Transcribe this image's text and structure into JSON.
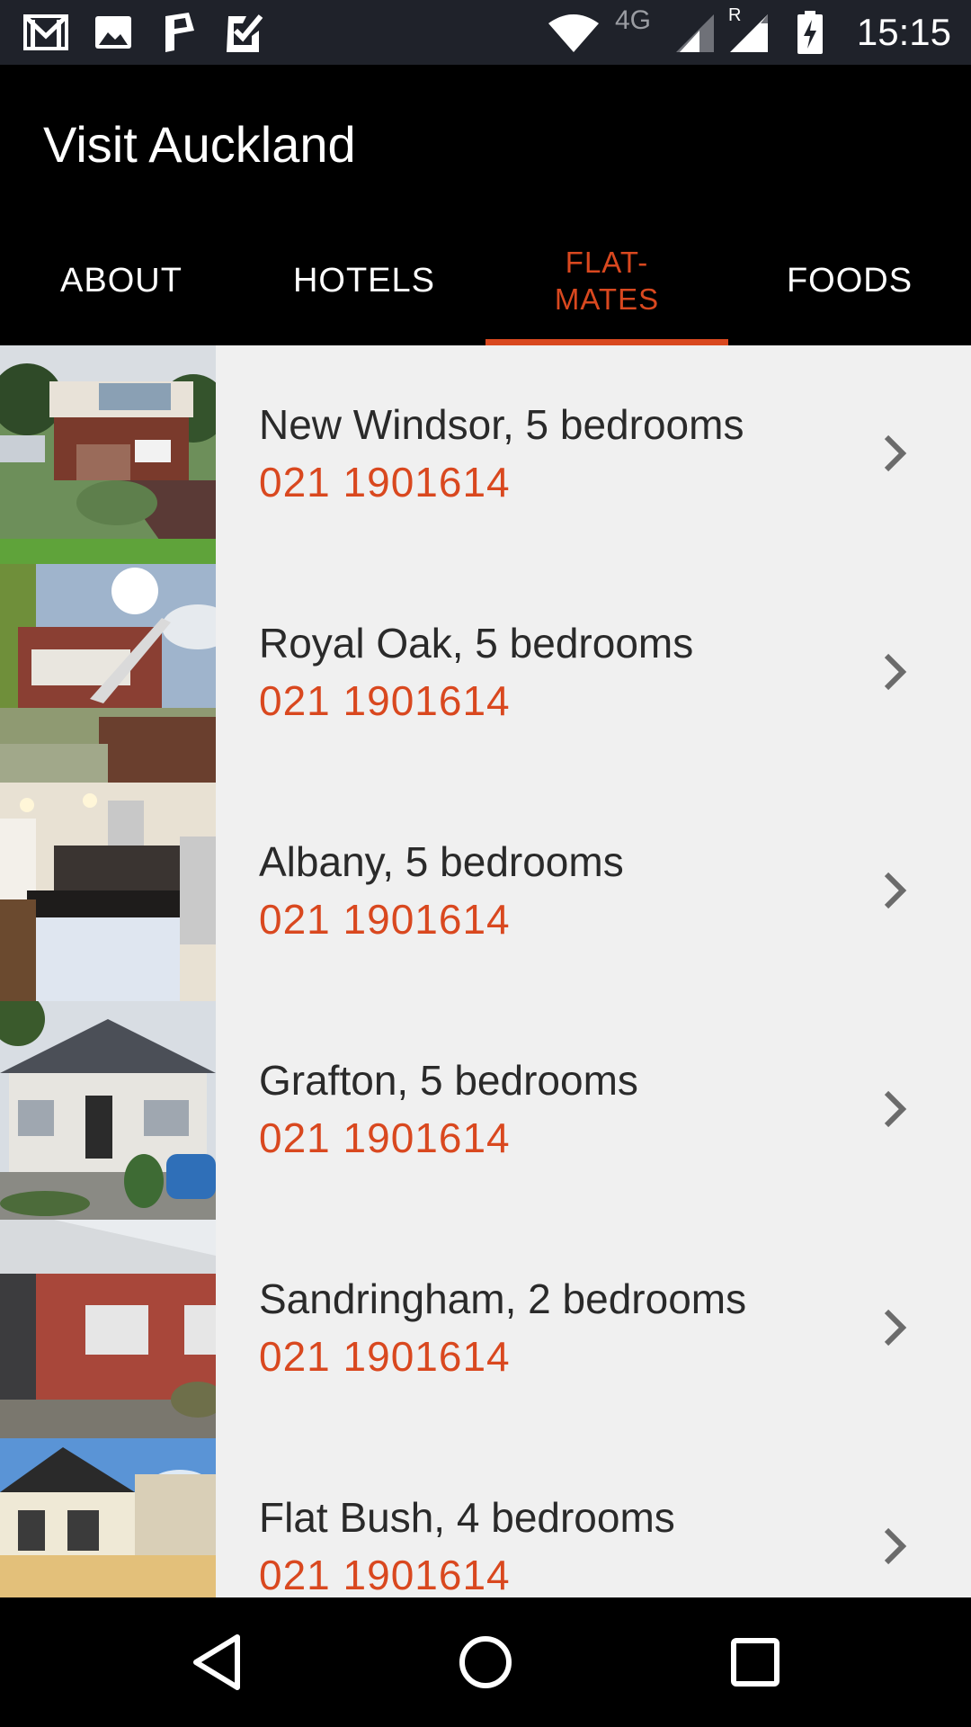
{
  "status_bar": {
    "time": "15:15",
    "network": "4G",
    "roaming": "R",
    "icons": [
      "gmail-icon",
      "image-icon",
      "parking-app-icon",
      "task-check-icon",
      "wifi-icon",
      "signal-icon",
      "roaming-signal-icon",
      "battery-charging-icon"
    ]
  },
  "app_bar": {
    "title": "Visit Auckland"
  },
  "tabs": [
    {
      "label": "ABOUT",
      "active": false
    },
    {
      "label": "HOTELS",
      "active": false
    },
    {
      "label": "FLAT-\nMATES",
      "active": true
    },
    {
      "label": "FOODS",
      "active": false
    }
  ],
  "listings": [
    {
      "title": "New Windsor, 5 bedrooms",
      "phone": "021 1901614",
      "image": "house-photo"
    },
    {
      "title": "Royal Oak, 5 bedrooms",
      "phone": "021 1901614",
      "image": "house-photo"
    },
    {
      "title": "Albany, 5 bedrooms",
      "phone": "021 1901614",
      "image": "kitchen-photo"
    },
    {
      "title": "Grafton, 5 bedrooms",
      "phone": "021 1901614",
      "image": "villa-photo"
    },
    {
      "title": "Sandringham, 2 bedrooms",
      "phone": "021 1901614",
      "image": "brick-unit-photo"
    },
    {
      "title": "Flat Bush, 4 bedrooms",
      "phone": "021 1901614",
      "image": "townhouse-photo"
    }
  ],
  "nav_bar": {
    "buttons": [
      "back-icon",
      "home-icon",
      "recents-icon"
    ]
  },
  "colors": {
    "accent": "#d9481f",
    "list_background": "#f0f0f0",
    "app_bar": "#000000",
    "status_bar": "#1f222a"
  }
}
